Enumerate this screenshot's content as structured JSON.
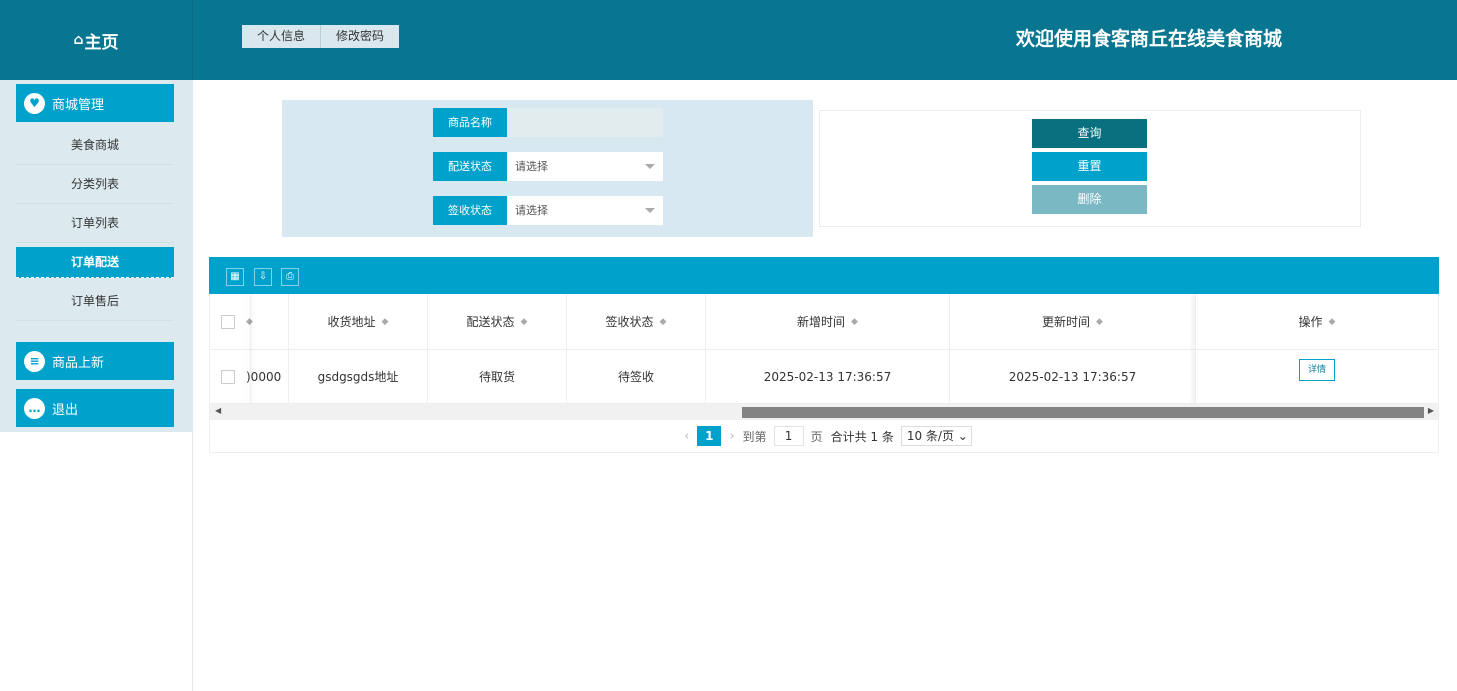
{
  "header": {
    "home_label": "主页",
    "home_icon": "home-icon",
    "tabs": [
      "个人信息",
      "修改密码"
    ],
    "welcome": "欢迎使用食客商丘在线美食商城"
  },
  "sidebar": {
    "groups": [
      {
        "label": "商城管理",
        "icon": "heart-icon"
      },
      {
        "label": "商品上新",
        "icon": "list-icon"
      },
      {
        "label": "退出",
        "icon": "chat-icon"
      }
    ],
    "items": [
      "美食商城",
      "分类列表",
      "订单列表",
      "订单配送",
      "订单售后"
    ],
    "active_item": "订单配送"
  },
  "search": {
    "name_label": "商品名称",
    "name_value": "",
    "delivery_label": "配送状态",
    "delivery_value": "请选择",
    "sign_label": "签收状态",
    "sign_value": "请选择"
  },
  "buttons": {
    "query": "查询",
    "reset": "重置",
    "delete": "删除",
    "colors": {
      "query": "#08707f",
      "reset": "#00a2cb",
      "delete": "#7ab8c3"
    }
  },
  "toolbar": {
    "icons": [
      "columns-icon",
      "export-icon",
      "print-icon"
    ]
  },
  "table": {
    "columns": [
      "",
      "收货地址",
      "配送状态",
      "签收状态",
      "新增时间",
      "更新时间",
      "操作"
    ],
    "rows": [
      {
        "id_partial": ")0000",
        "address": "gsdgsgds地址",
        "delivery_status": "待取货",
        "sign_status": "待签收",
        "created": "2025-02-13 17:36:57",
        "updated": "2025-02-13 17:36:57",
        "action": "详情"
      }
    ]
  },
  "pager": {
    "prev": "‹",
    "current": "1",
    "next": "›",
    "goto_label": "到第",
    "goto_value": "1",
    "page_unit": "页",
    "total": "合计共 1 条",
    "size": "10 条/页"
  }
}
